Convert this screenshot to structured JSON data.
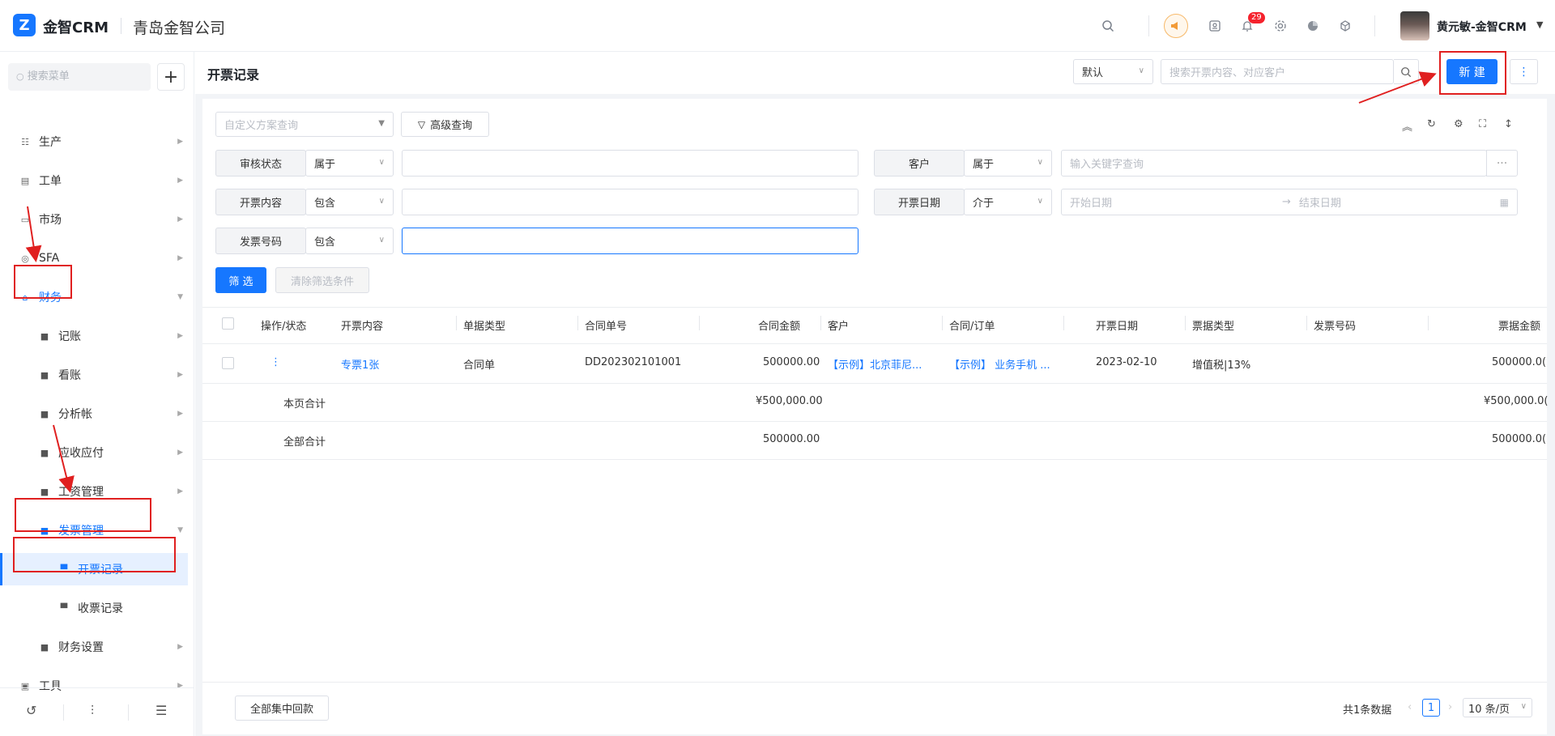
{
  "app": {
    "brand": "金智CRM",
    "company": "青岛金智公司",
    "badge_count": "29",
    "user_name": "黄元敏-金智CRM"
  },
  "sidebar": {
    "search_placeholder": "搜索菜单",
    "items": [
      {
        "label": "生产"
      },
      {
        "label": "工单"
      },
      {
        "label": "市场"
      },
      {
        "label": "SFA"
      },
      {
        "label": "财务"
      },
      {
        "label": "记账"
      },
      {
        "label": "看账"
      },
      {
        "label": "分析帐"
      },
      {
        "label": "应收应付"
      },
      {
        "label": "工资管理"
      },
      {
        "label": "发票管理"
      },
      {
        "label": "开票记录"
      },
      {
        "label": "收票记录"
      },
      {
        "label": "财务设置"
      },
      {
        "label": "工具"
      }
    ]
  },
  "header": {
    "title": "开票记录",
    "view_select": "默认",
    "search_placeholder": "搜索开票内容、对应客户",
    "new_button": "新 建"
  },
  "filter": {
    "scheme_placeholder": "自定义方案查询",
    "advanced_button": "高级查询",
    "rows": [
      {
        "label": "审核状态",
        "op": "属于"
      },
      {
        "label": "开票内容",
        "op": "包含"
      },
      {
        "label": "发票号码",
        "op": "包含"
      },
      {
        "label": "客户",
        "op": "属于",
        "placeholder": "输入关键字查询"
      },
      {
        "label": "开票日期",
        "op": "介于",
        "start_placeholder": "开始日期",
        "end_placeholder": "结束日期"
      }
    ],
    "filter_button": "筛 选",
    "clear_button": "清除筛选条件"
  },
  "table": {
    "columns": [
      "操作/状态",
      "开票内容",
      "单据类型",
      "合同单号",
      "合同金额",
      "客户",
      "合同/订单",
      "开票日期",
      "票据类型",
      "发票号码",
      "票据金额"
    ],
    "rows": [
      {
        "more": "⋮",
        "content": "专票1张",
        "doc_type": "合同单",
        "contract_no": "DD202302101001",
        "amount": "500000.00",
        "customer": "【示例】北京菲尼...",
        "order": "【示例】 业务手机 ...",
        "date": "2023-02-10",
        "invoice_type": "增值税|13%",
        "invoice_no": "",
        "invoice_amount": "500000.0("
      }
    ],
    "page_total_label": "本页合计",
    "page_total_amount": "¥500,000.00",
    "page_total_invoice": "¥500,000.0(",
    "all_total_label": "全部合计",
    "all_total_amount": "500000.00",
    "all_total_invoice": "500000.0("
  },
  "footer": {
    "collect_button": "全部集中回款",
    "total_text": "共1条数据",
    "current_page": "1",
    "page_size": "10 条/页"
  }
}
